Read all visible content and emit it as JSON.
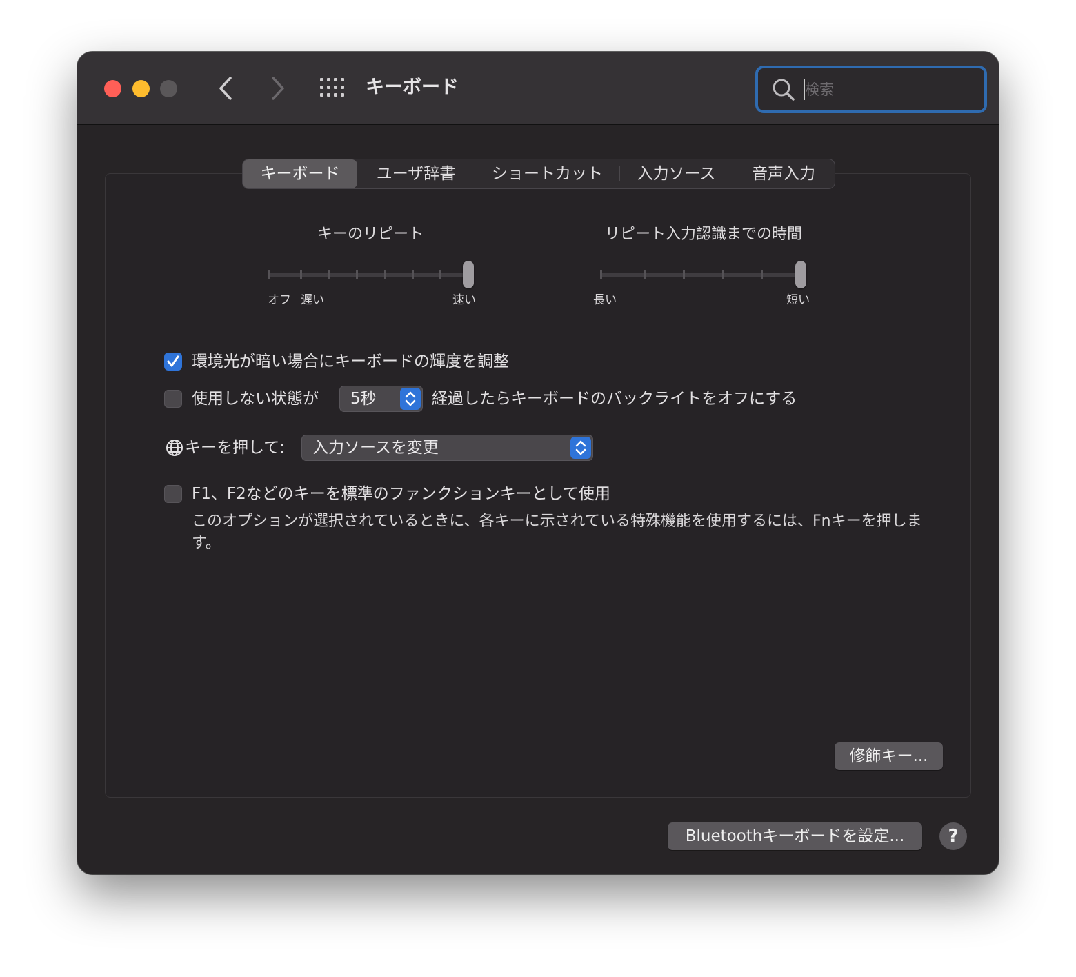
{
  "window": {
    "title": "キーボード",
    "search_placeholder": "検索",
    "icons": {
      "back": "chevron-left-icon",
      "forward": "chevron-right-icon",
      "grid": "grid-icon",
      "search": "search-icon"
    }
  },
  "tabs": [
    {
      "label": "キーボード",
      "selected": true
    },
    {
      "label": "ユーザ辞書",
      "selected": false
    },
    {
      "label": "ショートカット",
      "selected": false
    },
    {
      "label": "入力ソース",
      "selected": false
    },
    {
      "label": "音声入力",
      "selected": false
    }
  ],
  "sliders": {
    "key_repeat": {
      "label": "キーのリピート",
      "min_label": "オフ",
      "slow_label": "遅い",
      "max_label": "速い",
      "value": 1.0,
      "ticks": 8
    },
    "repeat_delay": {
      "label": "リピート入力認識までの時間",
      "min_label": "長い",
      "max_label": "短い",
      "value": 1.0,
      "ticks": 6
    }
  },
  "options": {
    "adjust_brightness": {
      "label": "環境光が暗い場合にキーボードの輝度を調整",
      "checked": true
    },
    "backlight_off": {
      "label_before": "使用しない状態が",
      "popup_value": "5秒",
      "label_after": "経過したらキーボードのバックライトをオフにする",
      "checked": false
    },
    "globe_key": {
      "label": "キーを押して:",
      "popup_value": "入力ソースを変更",
      "icon": "globe-icon"
    },
    "function_keys": {
      "label": "F1、F2などのキーを標準のファンクションキーとして使用",
      "description": "このオプションが選択されているときに、各キーに示されている特殊機能を使用するには、Fnキーを押します。",
      "checked": false
    }
  },
  "buttons": {
    "modifier_keys": "修飾キー...",
    "bluetooth_keyboard": "Bluetoothキーボードを設定...",
    "help": "?"
  },
  "colors": {
    "accent": "#2f74d9",
    "window_bg": "#272426",
    "titlebar_bg": "#353235",
    "close": "#ff5f57",
    "minimize": "#febc2e"
  }
}
